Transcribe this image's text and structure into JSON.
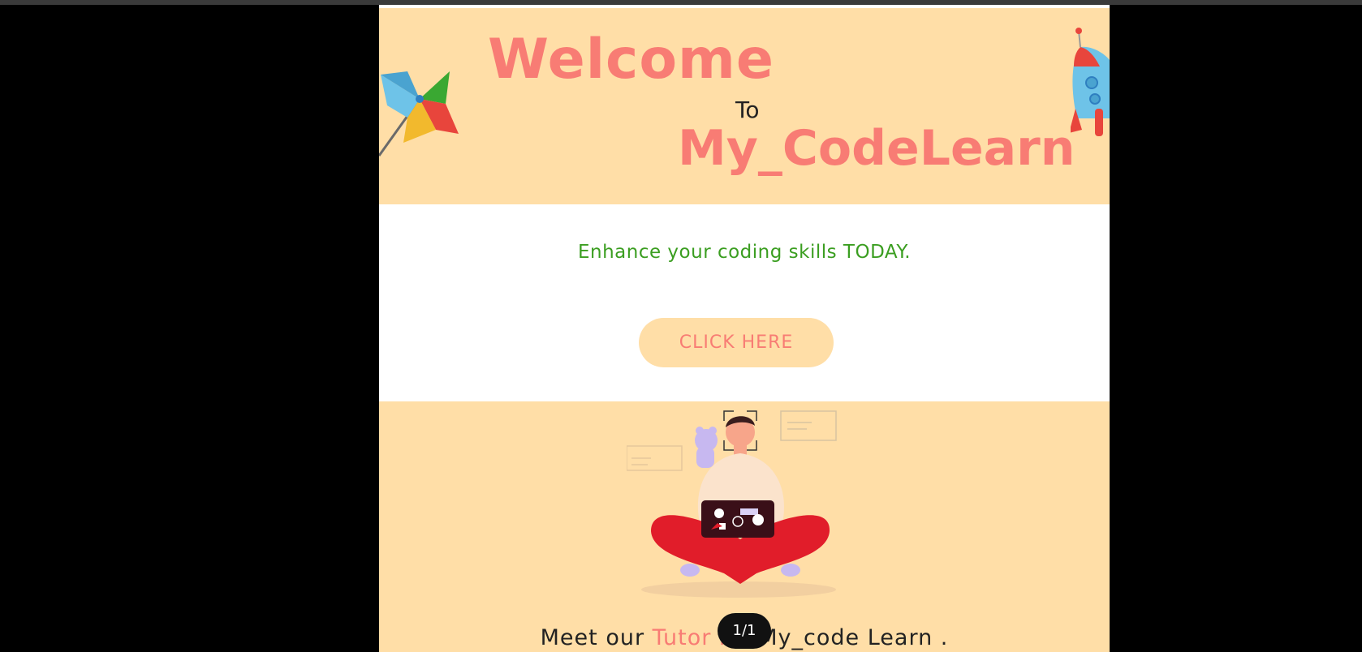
{
  "viewer": {
    "page_indicator": "1/1"
  },
  "hero": {
    "welcome": "Welcome",
    "to": "To",
    "brand": "My_CodeLearn"
  },
  "middle": {
    "tagline": "Enhance your coding skills TODAY.",
    "cta_label": "CLICK HERE"
  },
  "bottom": {
    "meet_prefix": "Meet our ",
    "meet_accent": "Tutor r",
    "meet_suffix": "in My_code Learn ."
  },
  "icons": {
    "pinwheel": "pinwheel-icon",
    "rocket": "rocket-icon",
    "illustration": "developer-with-laptop-illustration"
  },
  "colors": {
    "accent": "#f87c74",
    "hero_bg": "#ffdea7",
    "tagline": "#3b9e21"
  }
}
